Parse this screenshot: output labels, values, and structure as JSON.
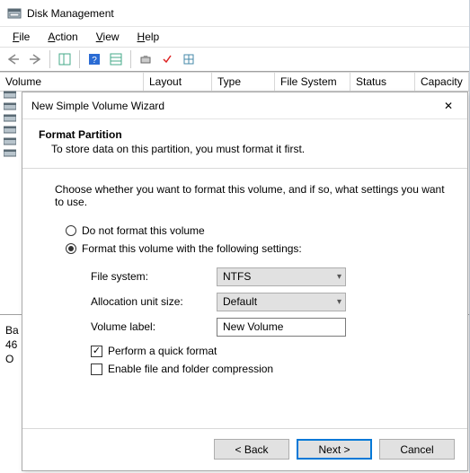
{
  "window": {
    "title": "Disk Management"
  },
  "menu": {
    "file": "File",
    "action": "Action",
    "view": "View",
    "help": "Help"
  },
  "columns": {
    "volume": "Volume",
    "layout": "Layout",
    "type": "Type",
    "filesystem": "File System",
    "status": "Status",
    "capacity": "Capacity"
  },
  "bottom": {
    "l1": "Ba",
    "l2": "46",
    "l3": "O"
  },
  "dialog": {
    "title": "New Simple Volume Wizard",
    "heading": "Format Partition",
    "subheading": "To store data on this partition, you must format it first.",
    "instruction": "Choose whether you want to format this volume, and if so, what settings you want to use.",
    "radio_noformat": "Do not format this volume",
    "radio_format": "Format this volume with the following settings:",
    "fs_label": "File system:",
    "fs_value": "NTFS",
    "aus_label": "Allocation unit size:",
    "aus_value": "Default",
    "vl_label": "Volume label:",
    "vl_value": "New Volume",
    "quick": "Perform a quick format",
    "compress": "Enable file and folder compression",
    "back": "< Back",
    "next": "Next >",
    "cancel": "Cancel"
  }
}
